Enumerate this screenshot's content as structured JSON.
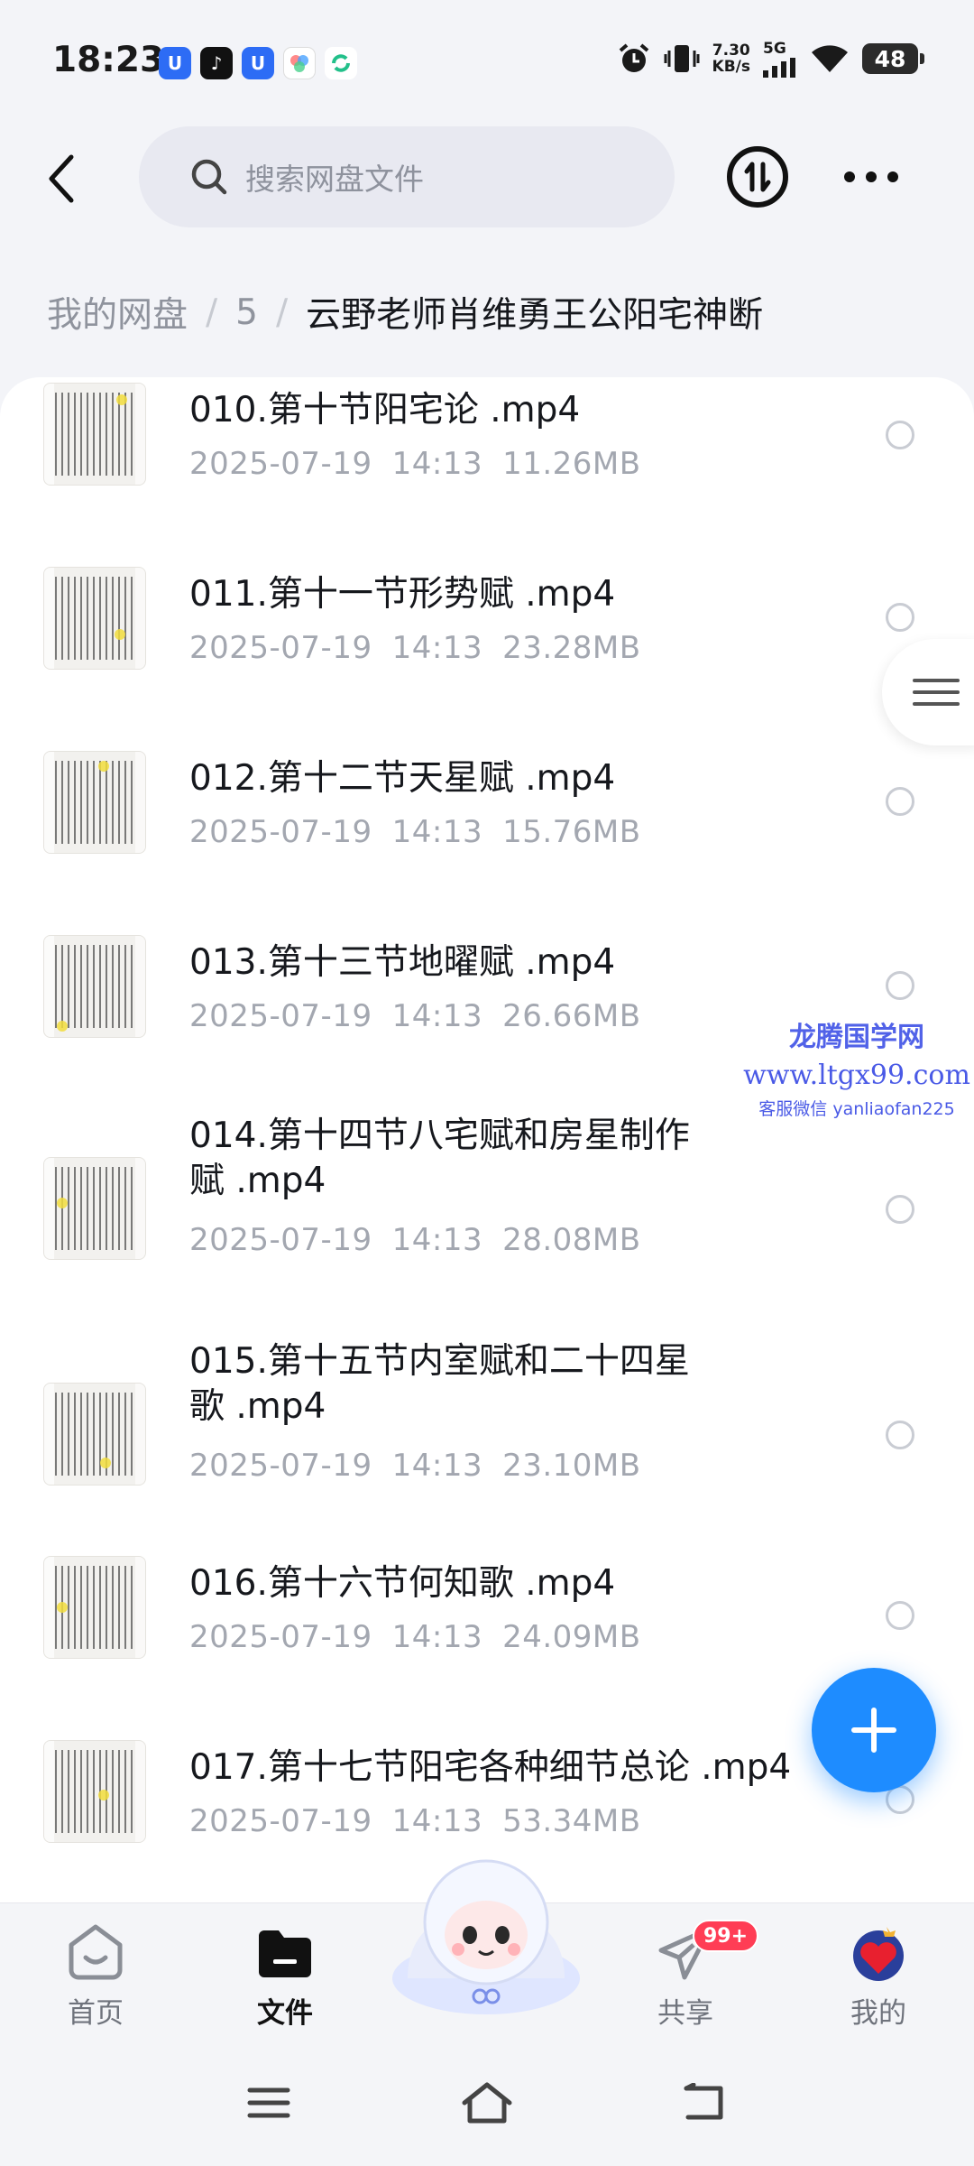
{
  "status_bar": {
    "time": "18:23",
    "speed_value": "7.30",
    "speed_unit": "KB/s",
    "network": "5G",
    "battery": "48"
  },
  "header": {
    "search_placeholder": "搜索网盘文件"
  },
  "breadcrumb": {
    "root": "我的网盘",
    "level1": "5",
    "current": "云野老师肖维勇王公阳宅神断"
  },
  "files": [
    {
      "name": "010.第十节阳宅论 .mp4",
      "date": "2025-07-19",
      "time": "14:13",
      "size": "11.26MB"
    },
    {
      "name": "011.第十一节形势赋 .mp4",
      "date": "2025-07-19",
      "time": "14:13",
      "size": "23.28MB"
    },
    {
      "name": "012.第十二节天星赋 .mp4",
      "date": "2025-07-19",
      "time": "14:13",
      "size": "15.76MB"
    },
    {
      "name": "013.第十三节地曜赋 .mp4",
      "date": "2025-07-19",
      "time": "14:13",
      "size": "26.66MB"
    },
    {
      "name_line1": "014.第十四节八宅赋和房星制作",
      "name_line2": "赋 .mp4",
      "date": "2025-07-19",
      "time": "14:13",
      "size": "28.08MB"
    },
    {
      "name_line1": "015.第十五节内室赋和二十四星",
      "name_line2": "歌 .mp4",
      "date": "2025-07-19",
      "time": "14:13",
      "size": "23.10MB"
    },
    {
      "name": "016.第十六节何知歌 .mp4",
      "date": "2025-07-19",
      "time": "14:13",
      "size": "24.09MB"
    },
    {
      "name": "017.第十七节阳宅各种细节总论 .mp4",
      "date": "2025-07-19",
      "time": "14:13",
      "size": "53.34MB"
    }
  ],
  "watermark": {
    "line1": "龙腾国学网",
    "line2": "www.ltgx99.com",
    "line3": "客服微信 yanliaofan225"
  },
  "tab_bar": {
    "home": "首页",
    "files": "文件",
    "share": "共享",
    "share_badge": "99+",
    "mine": "我的"
  },
  "colors": {
    "accent": "#1e8cff",
    "badge": "#ff3d55",
    "watermark": "#5162e8"
  }
}
